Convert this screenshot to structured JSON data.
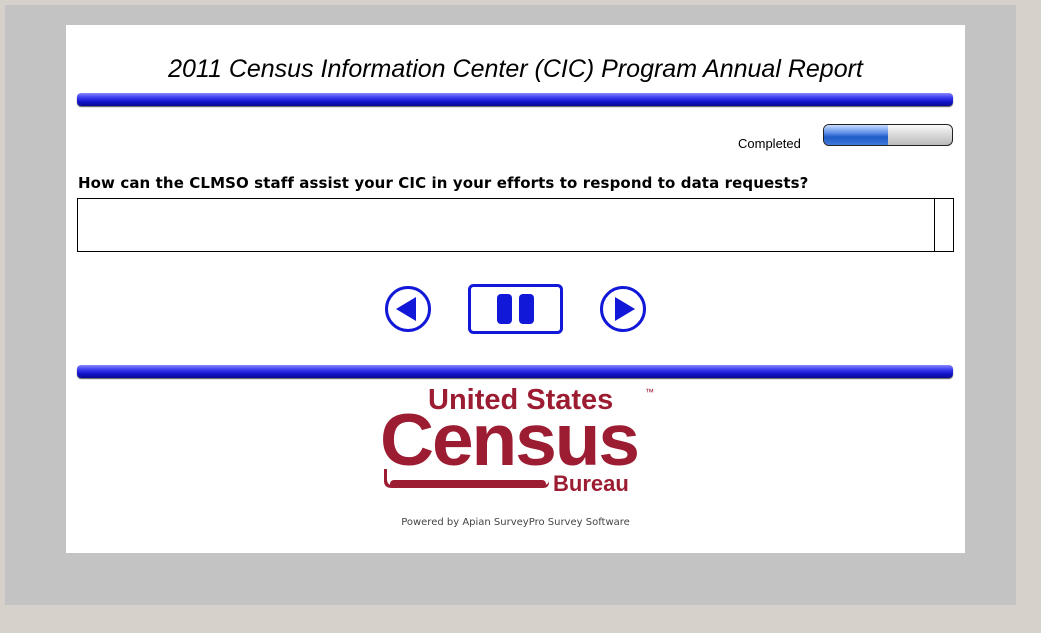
{
  "survey": {
    "title": "2011 Census Information Center (CIC) Program Annual Report"
  },
  "progress": {
    "label": "Completed",
    "fraction": 0.5
  },
  "question": {
    "text": "How can the CLMSO staff assist your CIC in your efforts to respond to data requests?",
    "answer_value": ""
  },
  "navigation": {
    "back_icon": "back-arrow-icon",
    "pause_icon": "pause-icon",
    "next_icon": "next-arrow-icon"
  },
  "logo": {
    "line1": "United States",
    "trademark": "™",
    "line2": "Census",
    "line3": "Bureau",
    "color": "#9c1c32"
  },
  "footer": {
    "powered_by": "Powered by Apian SurveyPro Survey Software"
  },
  "colors": {
    "accent_blue": "#1212c8",
    "background": "#d6d1ca",
    "panel": "#c3c3c3"
  }
}
